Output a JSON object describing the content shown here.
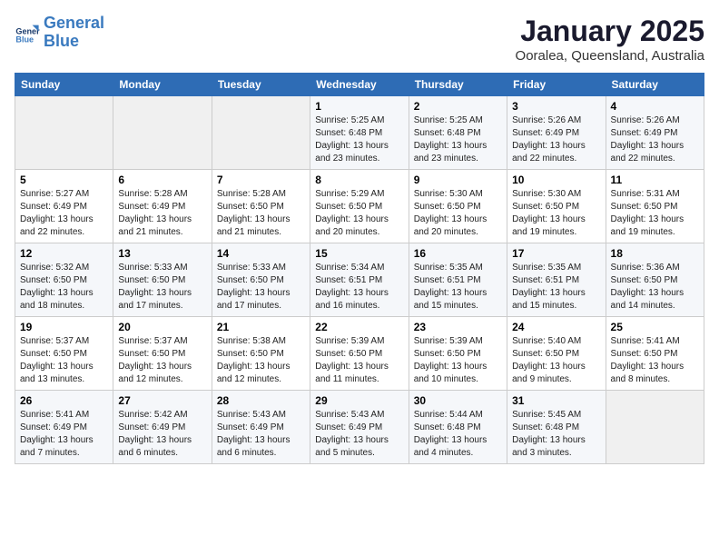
{
  "header": {
    "logo_line1": "General",
    "logo_line2": "Blue",
    "month": "January 2025",
    "location": "Ooralea, Queensland, Australia"
  },
  "weekdays": [
    "Sunday",
    "Monday",
    "Tuesday",
    "Wednesday",
    "Thursday",
    "Friday",
    "Saturday"
  ],
  "weeks": [
    [
      {
        "day": "",
        "info": ""
      },
      {
        "day": "",
        "info": ""
      },
      {
        "day": "",
        "info": ""
      },
      {
        "day": "1",
        "info": "Sunrise: 5:25 AM\nSunset: 6:48 PM\nDaylight: 13 hours\nand 23 minutes."
      },
      {
        "day": "2",
        "info": "Sunrise: 5:25 AM\nSunset: 6:48 PM\nDaylight: 13 hours\nand 23 minutes."
      },
      {
        "day": "3",
        "info": "Sunrise: 5:26 AM\nSunset: 6:49 PM\nDaylight: 13 hours\nand 22 minutes."
      },
      {
        "day": "4",
        "info": "Sunrise: 5:26 AM\nSunset: 6:49 PM\nDaylight: 13 hours\nand 22 minutes."
      }
    ],
    [
      {
        "day": "5",
        "info": "Sunrise: 5:27 AM\nSunset: 6:49 PM\nDaylight: 13 hours\nand 22 minutes."
      },
      {
        "day": "6",
        "info": "Sunrise: 5:28 AM\nSunset: 6:49 PM\nDaylight: 13 hours\nand 21 minutes."
      },
      {
        "day": "7",
        "info": "Sunrise: 5:28 AM\nSunset: 6:50 PM\nDaylight: 13 hours\nand 21 minutes."
      },
      {
        "day": "8",
        "info": "Sunrise: 5:29 AM\nSunset: 6:50 PM\nDaylight: 13 hours\nand 20 minutes."
      },
      {
        "day": "9",
        "info": "Sunrise: 5:30 AM\nSunset: 6:50 PM\nDaylight: 13 hours\nand 20 minutes."
      },
      {
        "day": "10",
        "info": "Sunrise: 5:30 AM\nSunset: 6:50 PM\nDaylight: 13 hours\nand 19 minutes."
      },
      {
        "day": "11",
        "info": "Sunrise: 5:31 AM\nSunset: 6:50 PM\nDaylight: 13 hours\nand 19 minutes."
      }
    ],
    [
      {
        "day": "12",
        "info": "Sunrise: 5:32 AM\nSunset: 6:50 PM\nDaylight: 13 hours\nand 18 minutes."
      },
      {
        "day": "13",
        "info": "Sunrise: 5:33 AM\nSunset: 6:50 PM\nDaylight: 13 hours\nand 17 minutes."
      },
      {
        "day": "14",
        "info": "Sunrise: 5:33 AM\nSunset: 6:50 PM\nDaylight: 13 hours\nand 17 minutes."
      },
      {
        "day": "15",
        "info": "Sunrise: 5:34 AM\nSunset: 6:51 PM\nDaylight: 13 hours\nand 16 minutes."
      },
      {
        "day": "16",
        "info": "Sunrise: 5:35 AM\nSunset: 6:51 PM\nDaylight: 13 hours\nand 15 minutes."
      },
      {
        "day": "17",
        "info": "Sunrise: 5:35 AM\nSunset: 6:51 PM\nDaylight: 13 hours\nand 15 minutes."
      },
      {
        "day": "18",
        "info": "Sunrise: 5:36 AM\nSunset: 6:50 PM\nDaylight: 13 hours\nand 14 minutes."
      }
    ],
    [
      {
        "day": "19",
        "info": "Sunrise: 5:37 AM\nSunset: 6:50 PM\nDaylight: 13 hours\nand 13 minutes."
      },
      {
        "day": "20",
        "info": "Sunrise: 5:37 AM\nSunset: 6:50 PM\nDaylight: 13 hours\nand 12 minutes."
      },
      {
        "day": "21",
        "info": "Sunrise: 5:38 AM\nSunset: 6:50 PM\nDaylight: 13 hours\nand 12 minutes."
      },
      {
        "day": "22",
        "info": "Sunrise: 5:39 AM\nSunset: 6:50 PM\nDaylight: 13 hours\nand 11 minutes."
      },
      {
        "day": "23",
        "info": "Sunrise: 5:39 AM\nSunset: 6:50 PM\nDaylight: 13 hours\nand 10 minutes."
      },
      {
        "day": "24",
        "info": "Sunrise: 5:40 AM\nSunset: 6:50 PM\nDaylight: 13 hours\nand 9 minutes."
      },
      {
        "day": "25",
        "info": "Sunrise: 5:41 AM\nSunset: 6:50 PM\nDaylight: 13 hours\nand 8 minutes."
      }
    ],
    [
      {
        "day": "26",
        "info": "Sunrise: 5:41 AM\nSunset: 6:49 PM\nDaylight: 13 hours\nand 7 minutes."
      },
      {
        "day": "27",
        "info": "Sunrise: 5:42 AM\nSunset: 6:49 PM\nDaylight: 13 hours\nand 6 minutes."
      },
      {
        "day": "28",
        "info": "Sunrise: 5:43 AM\nSunset: 6:49 PM\nDaylight: 13 hours\nand 6 minutes."
      },
      {
        "day": "29",
        "info": "Sunrise: 5:43 AM\nSunset: 6:49 PM\nDaylight: 13 hours\nand 5 minutes."
      },
      {
        "day": "30",
        "info": "Sunrise: 5:44 AM\nSunset: 6:48 PM\nDaylight: 13 hours\nand 4 minutes."
      },
      {
        "day": "31",
        "info": "Sunrise: 5:45 AM\nSunset: 6:48 PM\nDaylight: 13 hours\nand 3 minutes."
      },
      {
        "day": "",
        "info": ""
      }
    ]
  ]
}
